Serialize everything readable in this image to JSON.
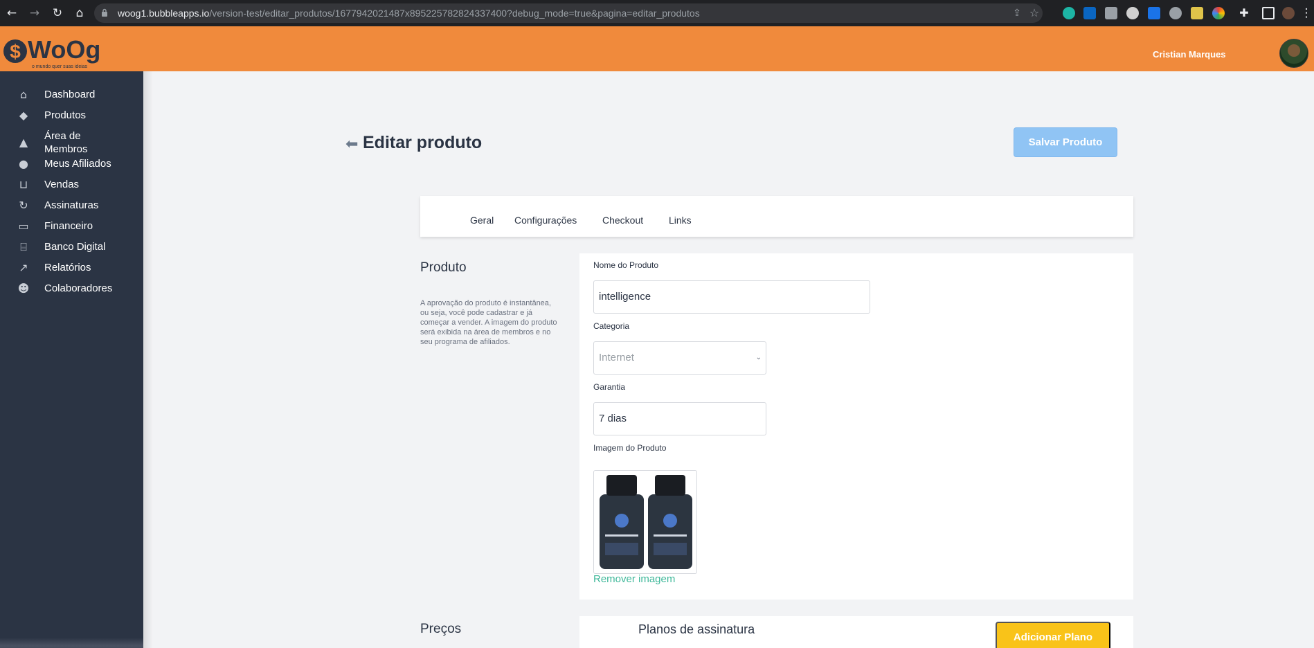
{
  "browser": {
    "url_host": "woog1.bubbleapps.io",
    "url_path": "/version-test/editar_produtos/1677942021487x895225782824337400?debug_mode=true&pagina=editar_produtos"
  },
  "header": {
    "user_name": "Cristian Marques"
  },
  "sidebar": {
    "items": [
      {
        "label": "Dashboard",
        "icon": "home-icon"
      },
      {
        "label": "Produtos",
        "icon": "tag-icon"
      },
      {
        "label": "Área de\nMembros",
        "icon": "graduation-cap-icon"
      },
      {
        "label": "Meus Afiliados",
        "icon": "user-icon"
      },
      {
        "label": "Vendas",
        "icon": "cart-icon"
      },
      {
        "label": "Assinaturas",
        "icon": "refresh-icon"
      },
      {
        "label": "Financeiro",
        "icon": "credit-card-icon"
      },
      {
        "label": "Banco Digital",
        "icon": "bank-icon"
      },
      {
        "label": "Relatórios",
        "icon": "line-chart-icon"
      },
      {
        "label": "Colaboradores",
        "icon": "users-icon"
      }
    ]
  },
  "main": {
    "title": "Editar produto",
    "save_label": "Salvar Produto",
    "tabs": [
      "Geral",
      "Configurações",
      "Checkout",
      "Links"
    ],
    "product_section": {
      "title": "Produto",
      "description": "A aprovação do produto é instantânea, ou seja, você pode cadastrar e já começar a vender. A imagem do produto será exibida na área de membros e no seu programa de afiliados."
    },
    "form": {
      "name_label": "Nome do Produto",
      "name_value": "intelligence",
      "category_label": "Categoria",
      "category_value": "Internet",
      "warranty_label": "Garantia",
      "warranty_value": "7 dias",
      "image_label": "Imagem do Produto",
      "remove_image": "Remover imagem"
    },
    "prices_section": {
      "title": "Preços",
      "plans_title": "Planos de assinatura",
      "add_plan_label": "Adicionar Plano"
    }
  },
  "colors": {
    "header_orange": "#f08a3c",
    "sidebar_dark": "#2b3444",
    "primary_blue": "#90c4f4",
    "accent_yellow": "#f9c319",
    "link_green": "#3fb89a"
  }
}
